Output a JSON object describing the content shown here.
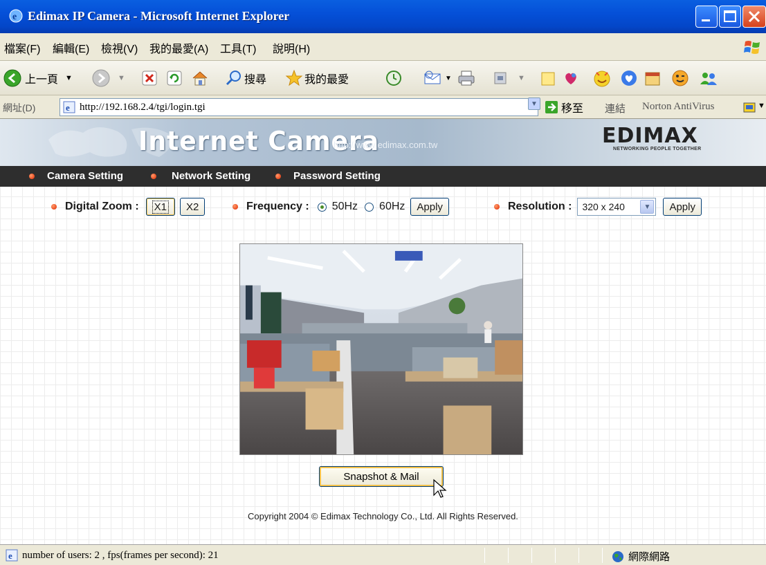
{
  "window": {
    "title": "Edimax IP Camera - Microsoft Internet Explorer"
  },
  "menu": {
    "items": [
      "檔案(F)",
      "編輯(E)",
      "檢視(V)",
      "我的最愛(A)",
      "工具(T)",
      "說明(H)"
    ]
  },
  "toolbar": {
    "back_label": "上一頁",
    "search_label": "搜尋",
    "favorites_label": "我的最愛"
  },
  "address": {
    "label": "網址(D)",
    "url": "http://192.168.2.4/tgi/login.tgi",
    "go_label": "移至",
    "links_label": "連結",
    "norton_label": "Norton AntiVirus"
  },
  "banner": {
    "title": "Internet Camera",
    "url": "http://www.edimax.com.tw",
    "logo_text": "EDIMAX",
    "logo_tagline": "NETWORKING PEOPLE TOGETHER"
  },
  "nav": {
    "items": [
      "Camera Setting",
      "Network Setting",
      "Password Setting"
    ]
  },
  "controls": {
    "zoom_label": "Digital Zoom :",
    "zoom_x1": "X1",
    "zoom_x2": "X2",
    "frequency_label": "Frequency :",
    "freq_50": "50Hz",
    "freq_60": "60Hz",
    "selected_frequency": "50Hz",
    "apply_label": "Apply",
    "resolution_label": "Resolution :",
    "resolution_value": "320 x 240"
  },
  "snapshot": {
    "label": "Snapshot & Mail"
  },
  "footer": {
    "copyright": "Copyright 2004 © Edimax Technology Co., Ltd.  All Rights Reserved."
  },
  "status": {
    "text": "number of users: 2 , fps(frames per second): 21",
    "zone": "網際網路"
  },
  "colors": {
    "titlebar": "#0550d8",
    "navbar": "#2e2e2e",
    "bullet": "#e02800"
  }
}
